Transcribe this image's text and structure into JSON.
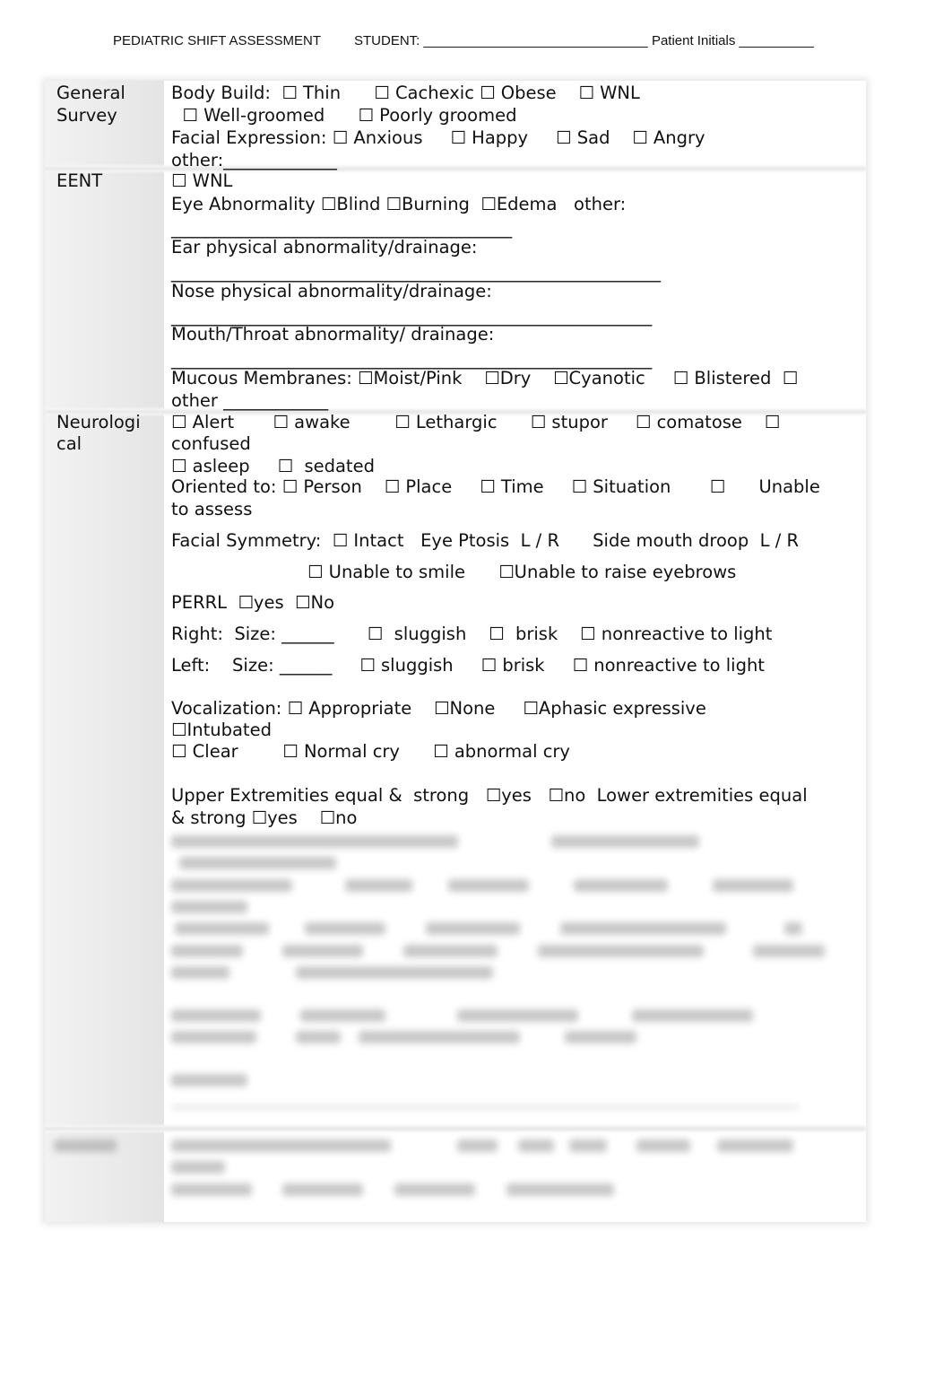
{
  "header": {
    "title": "PEDIATRIC SHIFT ASSESSMENT",
    "student": "STUDENT: ______________________________ Patient Initials __________"
  },
  "sections": {
    "general_survey": {
      "label": [
        "General",
        "Survey"
      ],
      "lines": [
        "Body Build:  ☐ Thin      ☐ Cachexic ☐ Obese    ☐ WNL",
        "  ☐ Well-groomed      ☐ Poorly groomed",
        "Facial Expression: ☐ Anxious     ☐ Happy     ☐ Sad    ☐ Angry",
        "other:_____________"
      ]
    },
    "eent": {
      "label": [
        "EENT"
      ],
      "lines": [
        "☐ WNL",
        "Eye Abnormality ☐Blind ☐Burning  ☐Edema   other:",
        "_______________________________________",
        "Ear physical abnormality/drainage:",
        "________________________________________________________",
        "Nose physical abnormality/drainage:",
        "_______________________________________________________",
        "Mouth/Throat abnormality/ drainage:",
        "_______________________________________________________",
        "Mucous Membranes: ☐Moist/Pink    ☐Dry    ☐Cyanotic     ☐ Blistered  ☐",
        "other ____________"
      ]
    },
    "neurological": {
      "label": [
        "Neurologi",
        "cal"
      ],
      "lines": [
        "☐ Alert       ☐ awake        ☐ Lethargic      ☐ stupor     ☐ comatose    ☐",
        "confused",
        "☐ asleep     ☐  sedated",
        "Oriented to: ☐ Person    ☐ Place     ☐ Time     ☐ Situation       ☐      Unable",
        "to assess",
        "Facial Symmetry:  ☐ Intact   Eye Ptosis  L / R      Side mouth droop  L / R",
        "☐ Unable to smile      ☐Unable to raise eyebrows",
        "PERRL  ☐yes  ☐No",
        "Right:  Size: ______      ☐  sluggish    ☐  brisk    ☐ nonreactive to light",
        "Left:    Size: ______     ☐ sluggish     ☐ brisk     ☐ nonreactive to light",
        "Vocalization: ☐ Appropriate    ☐None     ☐Aphasic expressive",
        "☐Intubated",
        "☐ Clear        ☐ Normal cry      ☐ abnormal cry",
        "Upper Extremities equal &  strong   ☐yes   ☐no  Lower extremities equal",
        "& strong ☐yes    ☐no"
      ]
    }
  }
}
